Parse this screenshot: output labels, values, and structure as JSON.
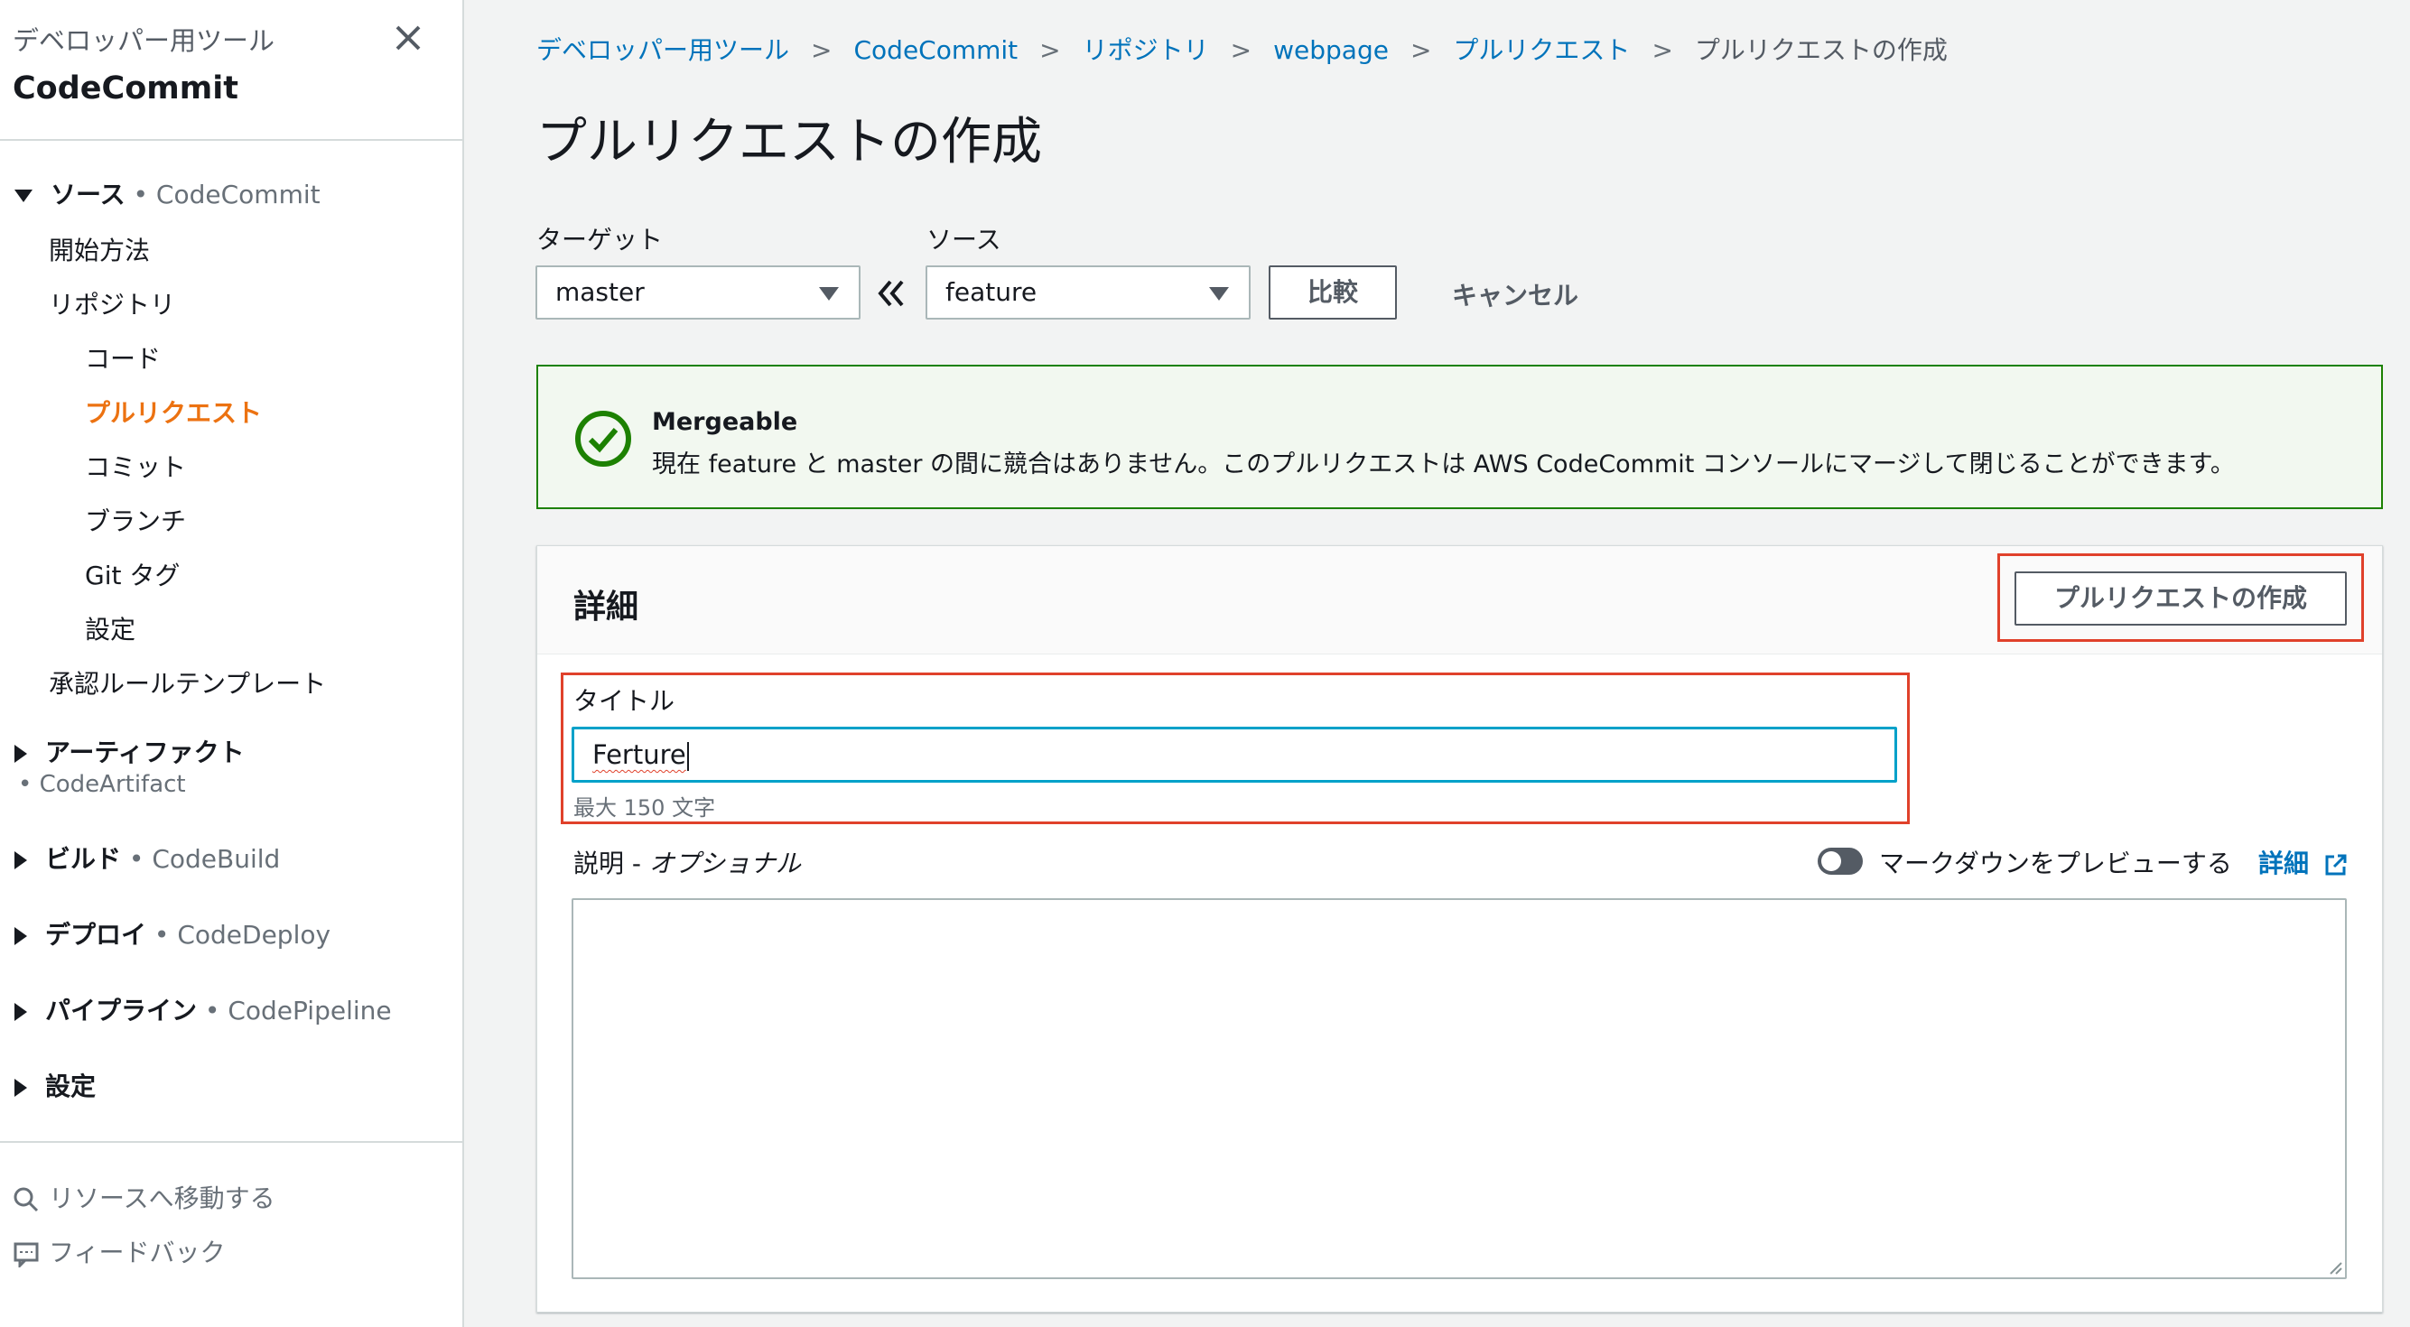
{
  "sidebar": {
    "subtitle": "デベロッパー用ツール",
    "title": "CodeCommit",
    "source_group": {
      "label": "ソース",
      "service": "• CodeCommit"
    },
    "items": {
      "getting_started": "開始方法",
      "repositories": "リポジトリ",
      "code": "コード",
      "pull_requests": "プルリクエスト",
      "commits": "コミット",
      "branches": "ブランチ",
      "git_tags": "Git タグ",
      "settings": "設定",
      "approval_templates": "承認ルールテンプレート"
    },
    "groups": {
      "artifacts": {
        "label": "アーティファクト",
        "service": "• CodeArtifact"
      },
      "build": {
        "label": "ビルド",
        "service": "• CodeBuild"
      },
      "deploy": {
        "label": "デプロイ",
        "service": "• CodeDeploy"
      },
      "pipeline": {
        "label": "パイプライン",
        "service": "• CodePipeline"
      },
      "settings": {
        "label": "設定"
      }
    },
    "footer": {
      "goto_resource": "リソースへ移動する",
      "feedback": "フィードバック"
    }
  },
  "breadcrumb": {
    "items": [
      "デベロッパー用ツール",
      "CodeCommit",
      "リポジトリ",
      "webpage",
      "プルリクエスト"
    ],
    "current": "プルリクエストの作成"
  },
  "page": {
    "title": "プルリクエストの作成"
  },
  "compare": {
    "target_label": "ターゲット",
    "target_value": "master",
    "source_label": "ソース",
    "source_value": "feature",
    "compare_button": "比較",
    "cancel_button": "キャンセル"
  },
  "alert": {
    "title": "Mergeable",
    "message": "現在 feature と master の間に競合はありません。このプルリクエストは AWS CodeCommit コンソールにマージして閉じることができます。"
  },
  "details": {
    "title": "詳細",
    "create_button": "プルリクエストの作成",
    "title_field_label": "タイトル",
    "title_field_value": "Ferture",
    "title_hint": "最大 150 文字",
    "description_label": "説明 - ",
    "description_optional": "オプショナル",
    "markdown_preview_label": "マークダウンをプレビューする",
    "more_link": "詳細"
  },
  "colors": {
    "accent_orange": "#ec7211",
    "link_blue": "#0073bb",
    "success_green": "#1d8102",
    "highlight_red": "#e0412b",
    "focus_cyan": "#00a1c9"
  }
}
